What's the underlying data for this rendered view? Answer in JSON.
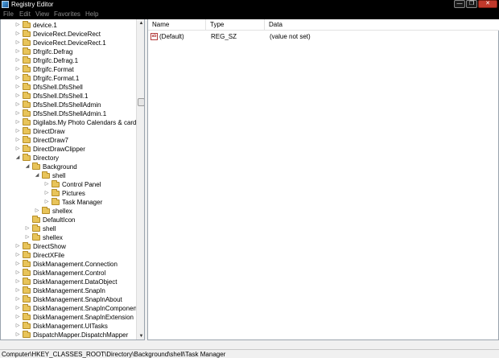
{
  "window": {
    "title": "Registry Editor",
    "controls": {
      "minimize": "—",
      "maximize": "❐",
      "close": "✕"
    }
  },
  "menu": [
    "File",
    "Edit",
    "View",
    "Favorites",
    "Help"
  ],
  "tree": [
    {
      "label": "device.1",
      "level": 0,
      "expander": "▷"
    },
    {
      "label": "DeviceRect.DeviceRect",
      "level": 0,
      "expander": "▷"
    },
    {
      "label": "DeviceRect.DeviceRect.1",
      "level": 0,
      "expander": "▷"
    },
    {
      "label": "Dfrgifc.Defrag",
      "level": 0,
      "expander": "▷"
    },
    {
      "label": "Dfrgifc.Defrag.1",
      "level": 0,
      "expander": "▷"
    },
    {
      "label": "Dfrgifc.Format",
      "level": 0,
      "expander": "▷"
    },
    {
      "label": "Dfrgifc.Format.1",
      "level": 0,
      "expander": "▷"
    },
    {
      "label": "DfsShell.DfsShell",
      "level": 0,
      "expander": "▷"
    },
    {
      "label": "DfsShell.DfsShell.1",
      "level": 0,
      "expander": "▷"
    },
    {
      "label": "DfsShell.DfsShellAdmin",
      "level": 0,
      "expander": "▷"
    },
    {
      "label": "DfsShell.DfsShellAdmin.1",
      "level": 0,
      "expander": "▷"
    },
    {
      "label": "Digilabs.My Photo Calendars & cards",
      "level": 0,
      "expander": "▷"
    },
    {
      "label": "DirectDraw",
      "level": 0,
      "expander": "▷"
    },
    {
      "label": "DirectDraw7",
      "level": 0,
      "expander": "▷"
    },
    {
      "label": "DirectDrawClipper",
      "level": 0,
      "expander": "▷"
    },
    {
      "label": "Directory",
      "level": 0,
      "expander": "◢"
    },
    {
      "label": "Background",
      "level": 1,
      "expander": "◢"
    },
    {
      "label": "shell",
      "level": 2,
      "expander": "◢"
    },
    {
      "label": "Control Panel",
      "level": 3,
      "expander": "▷"
    },
    {
      "label": "Pictures",
      "level": 3,
      "expander": "▷"
    },
    {
      "label": "Task Manager",
      "level": 3,
      "expander": "▷"
    },
    {
      "label": "shellex",
      "level": 2,
      "expander": "▷"
    },
    {
      "label": "DefaultIcon",
      "level": 1,
      "expander": ""
    },
    {
      "label": "shell",
      "level": 1,
      "expander": "▷"
    },
    {
      "label": "shellex",
      "level": 1,
      "expander": "▷"
    },
    {
      "label": "DirectShow",
      "level": 0,
      "expander": "▷"
    },
    {
      "label": "DirectXFile",
      "level": 0,
      "expander": "▷"
    },
    {
      "label": "DiskManagement.Connection",
      "level": 0,
      "expander": "▷"
    },
    {
      "label": "DiskManagement.Control",
      "level": 0,
      "expander": "▷"
    },
    {
      "label": "DiskManagement.DataObject",
      "level": 0,
      "expander": "▷"
    },
    {
      "label": "DiskManagement.SnapIn",
      "level": 0,
      "expander": "▷"
    },
    {
      "label": "DiskManagement.SnapInAbout",
      "level": 0,
      "expander": "▷"
    },
    {
      "label": "DiskManagement.SnapInComponent",
      "level": 0,
      "expander": "▷"
    },
    {
      "label": "DiskManagement.SnapInExtension",
      "level": 0,
      "expander": "▷"
    },
    {
      "label": "DiskManagement.UITasks",
      "level": 0,
      "expander": "▷"
    },
    {
      "label": "DispatchMapper.DispatchMapper",
      "level": 0,
      "expander": "▷"
    }
  ],
  "list": {
    "columns": {
      "name": "Name",
      "type": "Type",
      "data": "Data"
    },
    "rows": [
      {
        "icon": "ab",
        "name": "(Default)",
        "type": "REG_SZ",
        "data": "(value not set)"
      }
    ]
  },
  "status": {
    "path": "Computer\\HKEY_CLASSES_ROOT\\Directory\\Background\\shell\\Task Manager"
  },
  "scrollbar": {
    "up": "▲",
    "down": "▼"
  }
}
